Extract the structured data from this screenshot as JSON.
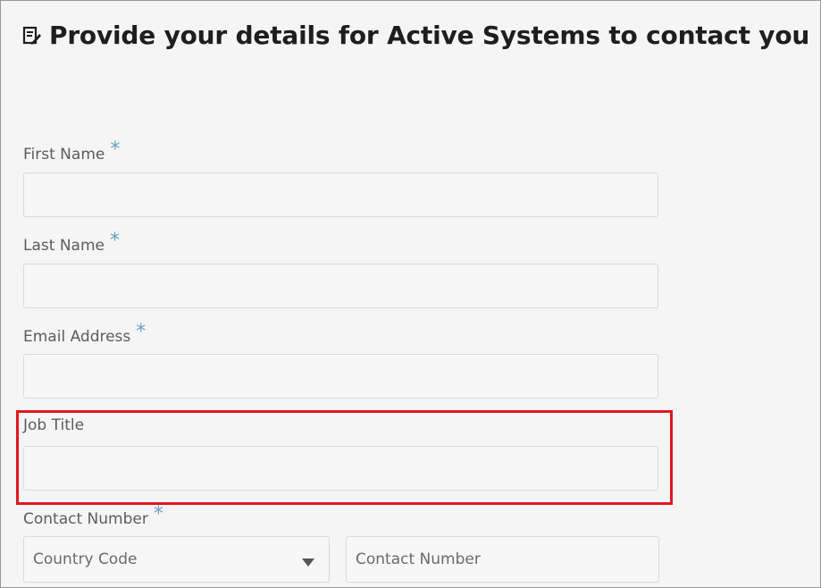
{
  "page": {
    "title": "Provide your details for Active Systems to contact you",
    "title_icon": "form-edit-icon"
  },
  "form": {
    "first_name": {
      "label": "First Name",
      "required_mark": "*",
      "value": ""
    },
    "last_name": {
      "label": "Last Name",
      "required_mark": "*",
      "value": ""
    },
    "email": {
      "label": "Email Address",
      "required_mark": "*",
      "value": ""
    },
    "job_title": {
      "label": "Job Title",
      "value": ""
    },
    "contact_number": {
      "label": "Contact Number",
      "required_mark": "*",
      "country_code_placeholder": "Country Code",
      "number_placeholder": "Contact Number"
    }
  },
  "colors": {
    "highlight": "#e0171e",
    "required": "#6aa0c8",
    "background": "#f5f5f5"
  }
}
